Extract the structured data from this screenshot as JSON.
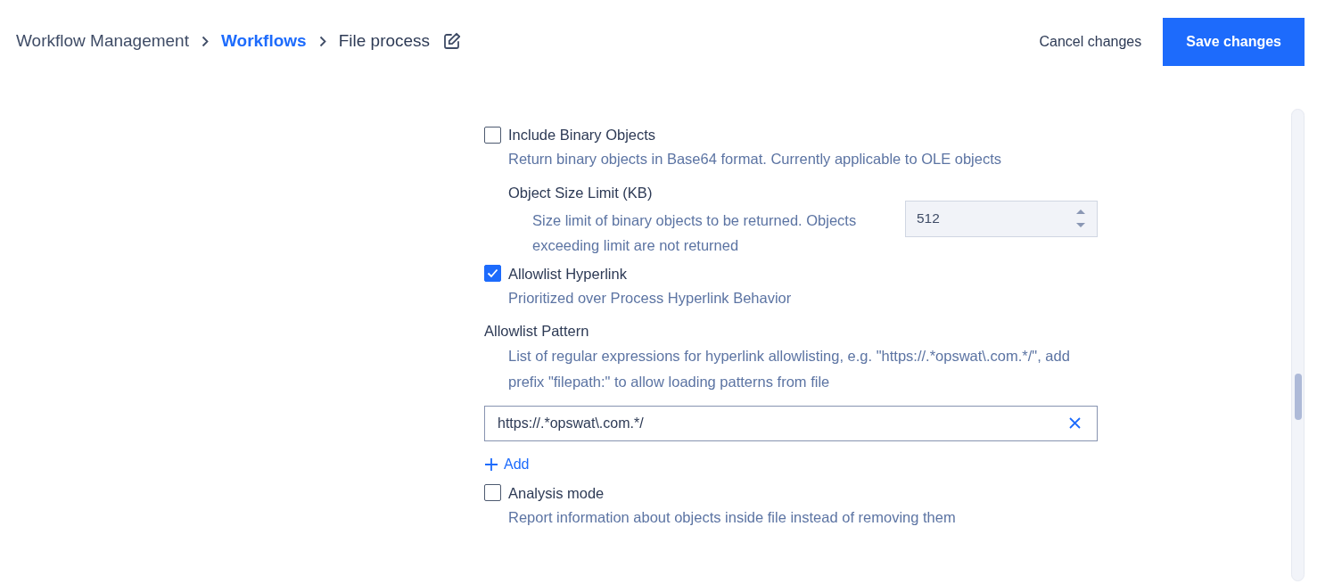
{
  "breadcrumb": [
    {
      "label": "Workflow Management",
      "kind": "plain"
    },
    {
      "label": "Workflows",
      "kind": "link"
    },
    {
      "label": "File process",
      "kind": "current"
    }
  ],
  "actions": {
    "cancel": "Cancel changes",
    "save": "Save changes"
  },
  "settings": [
    {
      "kind": "checkbox",
      "label": "Include Binary Objects",
      "checked": false,
      "description": "Return binary objects in Base64 format. Currently applicable to OLE objects"
    },
    {
      "kind": "number",
      "label": "Object Size Limit (KB)",
      "description": "Size limit of binary objects to be returned. Objects exceeding limit are not returned",
      "value": "512"
    },
    {
      "kind": "checkbox",
      "label": "Allowlist Hyperlink",
      "checked": true,
      "description": "Prioritized over Process Hyperlink Behavior"
    },
    {
      "kind": "pattern",
      "label": "Allowlist Pattern",
      "description": "List of regular expressions for hyperlink allowlisting, e.g. \"https://.*opswat\\.com.*/\", add prefix \"filepath:\" to allow loading patterns from file",
      "values": [
        "https://.*opswat\\.com.*/"
      ],
      "add_label": "Add"
    },
    {
      "kind": "checkbox",
      "label": "Analysis mode",
      "checked": false,
      "description": "Report information about objects inside file instead of removing them"
    }
  ]
}
